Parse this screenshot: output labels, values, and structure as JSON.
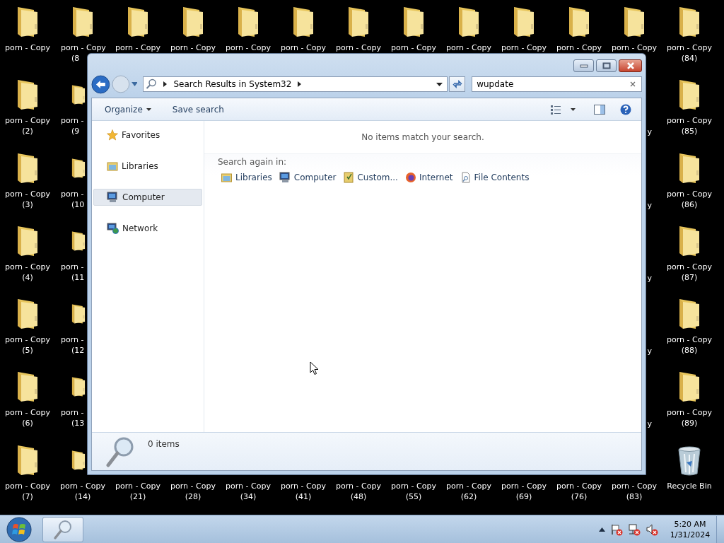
{
  "desktop": {
    "columns": [
      [
        {
          "kind": "folder",
          "lines": [
            "porn - Copy"
          ]
        },
        {
          "kind": "folder",
          "lines": [
            "porn - Copy",
            "(2)"
          ]
        },
        {
          "kind": "folder",
          "lines": [
            "porn - Copy",
            "(3)"
          ]
        },
        {
          "kind": "folder",
          "lines": [
            "porn - Copy",
            "(4)"
          ]
        },
        {
          "kind": "folder",
          "lines": [
            "porn - Copy",
            "(5)"
          ]
        },
        {
          "kind": "folder",
          "lines": [
            "porn - Copy",
            "(6)"
          ]
        },
        {
          "kind": "folder",
          "lines": [
            "porn - Copy",
            "(7)"
          ]
        }
      ],
      [
        {
          "kind": "folder_cut",
          "lines": [
            "porn - Copy",
            "(8"
          ]
        },
        {
          "kind": "folder_part_cut",
          "lines": [
            "porn -",
            "(9"
          ]
        },
        {
          "kind": "folder_part_cut",
          "lines": [
            "porn -",
            "(10"
          ]
        },
        {
          "kind": "folder_part_cut",
          "lines": [
            "porn -",
            "(11"
          ]
        },
        {
          "kind": "folder_part_cut",
          "lines": [
            "porn -",
            "(12"
          ]
        },
        {
          "kind": "folder_part_cut",
          "lines": [
            "porn -",
            "(13"
          ]
        },
        {
          "kind": "folder_part",
          "lines": [
            "porn - Copy",
            "(14)"
          ]
        }
      ],
      [
        {
          "kind": "folder",
          "lines": [
            "porn - Copy"
          ]
        },
        {
          "kind": "covered"
        },
        {
          "kind": "covered"
        },
        {
          "kind": "covered"
        },
        {
          "kind": "covered"
        },
        {
          "kind": "covered"
        },
        {
          "kind": "label",
          "lines": [
            "porn - Copy",
            "(21)"
          ]
        }
      ],
      [
        {
          "kind": "folder",
          "lines": [
            "porn - Copy"
          ]
        },
        {
          "kind": "covered"
        },
        {
          "kind": "covered"
        },
        {
          "kind": "covered"
        },
        {
          "kind": "covered"
        },
        {
          "kind": "covered"
        },
        {
          "kind": "label",
          "lines": [
            "porn - Copy",
            "(28)"
          ]
        }
      ],
      [
        {
          "kind": "folder",
          "lines": [
            "porn - Copy"
          ]
        },
        {
          "kind": "covered"
        },
        {
          "kind": "covered"
        },
        {
          "kind": "covered"
        },
        {
          "kind": "covered"
        },
        {
          "kind": "covered"
        },
        {
          "kind": "label",
          "lines": [
            "porn - Copy",
            "(34)"
          ]
        }
      ],
      [
        {
          "kind": "folder",
          "lines": [
            "porn - Copy"
          ]
        },
        {
          "kind": "covered"
        },
        {
          "kind": "covered"
        },
        {
          "kind": "covered"
        },
        {
          "kind": "covered"
        },
        {
          "kind": "covered"
        },
        {
          "kind": "label",
          "lines": [
            "porn - Copy",
            "(41)"
          ]
        }
      ],
      [
        {
          "kind": "folder",
          "lines": [
            "porn - Copy"
          ]
        },
        {
          "kind": "covered"
        },
        {
          "kind": "covered"
        },
        {
          "kind": "covered"
        },
        {
          "kind": "covered"
        },
        {
          "kind": "covered"
        },
        {
          "kind": "label",
          "lines": [
            "porn - Copy",
            "(48)"
          ]
        }
      ],
      [
        {
          "kind": "folder",
          "lines": [
            "porn - Copy"
          ]
        },
        {
          "kind": "covered"
        },
        {
          "kind": "covered"
        },
        {
          "kind": "covered"
        },
        {
          "kind": "covered"
        },
        {
          "kind": "covered"
        },
        {
          "kind": "label",
          "lines": [
            "porn - Copy",
            "(55)"
          ]
        }
      ],
      [
        {
          "kind": "folder",
          "lines": [
            "porn - Copy"
          ]
        },
        {
          "kind": "covered"
        },
        {
          "kind": "covered"
        },
        {
          "kind": "covered"
        },
        {
          "kind": "covered"
        },
        {
          "kind": "covered"
        },
        {
          "kind": "label",
          "lines": [
            "porn - Copy",
            "(62)"
          ]
        }
      ],
      [
        {
          "kind": "folder",
          "lines": [
            "porn - Copy"
          ]
        },
        {
          "kind": "covered"
        },
        {
          "kind": "covered"
        },
        {
          "kind": "covered"
        },
        {
          "kind": "covered"
        },
        {
          "kind": "covered"
        },
        {
          "kind": "label",
          "lines": [
            "porn - Copy",
            "(69)"
          ]
        }
      ],
      [
        {
          "kind": "folder",
          "lines": [
            "porn - Copy"
          ]
        },
        {
          "kind": "covered"
        },
        {
          "kind": "covered"
        },
        {
          "kind": "covered"
        },
        {
          "kind": "covered"
        },
        {
          "kind": "covered"
        },
        {
          "kind": "label",
          "lines": [
            "porn - Copy",
            "(76)"
          ]
        }
      ],
      [
        {
          "kind": "folder",
          "lines": [
            "porn - Copy"
          ]
        },
        {
          "kind": "label_tail",
          "lines": [
            "y"
          ]
        },
        {
          "kind": "label_tail",
          "lines": [
            "y"
          ]
        },
        {
          "kind": "label_tail",
          "lines": [
            "y"
          ]
        },
        {
          "kind": "label_tail",
          "lines": [
            "y"
          ]
        },
        {
          "kind": "label_tail",
          "lines": [
            "y"
          ]
        },
        {
          "kind": "label",
          "lines": [
            "porn - Copy",
            "(83)"
          ]
        }
      ],
      [
        {
          "kind": "folder",
          "lines": [
            "porn - Copy",
            "(84)"
          ]
        },
        {
          "kind": "folder",
          "lines": [
            "porn - Copy",
            "(85)"
          ]
        },
        {
          "kind": "folder",
          "lines": [
            "porn - Copy",
            "(86)"
          ]
        },
        {
          "kind": "folder",
          "lines": [
            "porn - Copy",
            "(87)"
          ]
        },
        {
          "kind": "folder",
          "lines": [
            "porn - Copy",
            "(88)"
          ]
        },
        {
          "kind": "folder",
          "lines": [
            "porn - Copy",
            "(89)"
          ]
        },
        {
          "kind": "recycle_bin",
          "lines": [
            "Recycle Bin"
          ]
        }
      ]
    ]
  },
  "window": {
    "address": {
      "segments": [
        "Search Results in System32"
      ]
    },
    "search": {
      "value": "wupdate"
    },
    "toolbar": {
      "buttons": [
        {
          "label": "Organize",
          "dropdown": true
        },
        {
          "label": "Save search",
          "dropdown": false
        }
      ]
    },
    "nav_pane": {
      "items": [
        {
          "kind": "favorites",
          "label": "Favorites",
          "selected": false
        },
        {
          "kind": "libraries",
          "label": "Libraries",
          "selected": false
        },
        {
          "kind": "computer",
          "label": "Computer",
          "selected": true
        },
        {
          "kind": "network",
          "label": "Network",
          "selected": false
        }
      ]
    },
    "message": "No items match your search.",
    "search_again": {
      "label": "Search again in:",
      "options": [
        {
          "kind": "libraries",
          "label": "Libraries"
        },
        {
          "kind": "computer",
          "label": "Computer"
        },
        {
          "kind": "custom",
          "label": "Custom..."
        },
        {
          "kind": "internet",
          "label": "Internet"
        },
        {
          "kind": "file_contents",
          "label": "File Contents"
        }
      ]
    },
    "details": {
      "count": "0 items"
    }
  },
  "taskbar": {
    "clock": {
      "time": "5:20 AM",
      "date": "1/31/2024"
    }
  }
}
